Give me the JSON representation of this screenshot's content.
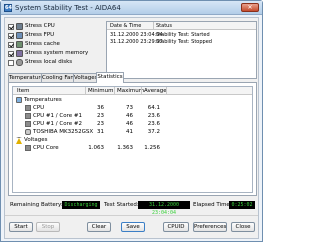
{
  "window": {
    "title": "System Stability Test - AIDA64",
    "icon_glyph": "64"
  },
  "stress_options": [
    {
      "label": "Stress CPU",
      "checked": true,
      "icon": "cpu-icon"
    },
    {
      "label": "Stress FPU",
      "checked": true,
      "icon": "fpu-icon"
    },
    {
      "label": "Stress cache",
      "checked": true,
      "icon": "cache-icon"
    },
    {
      "label": "Stress system memory",
      "checked": true,
      "icon": "memory-icon"
    },
    {
      "label": "Stress local disks",
      "checked": false,
      "icon": "disk-icon"
    }
  ],
  "log": {
    "headers": [
      "Date & Time",
      "Status"
    ],
    "rows": [
      {
        "datetime": "31.12.2000 23:04:04",
        "status": "Stability Test: Started"
      },
      {
        "datetime": "31.12.2000 23:29:07",
        "status": "Stability Test: Stopped"
      }
    ]
  },
  "tabs": [
    "Temperatures",
    "Cooling Fans",
    "Voltages",
    "Statistics"
  ],
  "active_tab": "Statistics",
  "stats": {
    "headers": [
      "Item",
      "Minimum",
      "Maximum",
      "Average"
    ],
    "groups": [
      {
        "label": "Temperatures",
        "rows": [
          {
            "item": "CPU",
            "min": "36",
            "max": "73",
            "avg": "64.1"
          },
          {
            "item": "CPU #1 / Core #1",
            "min": "23",
            "max": "46",
            "avg": "23.6"
          },
          {
            "item": "CPU #1 / Core #2",
            "min": "23",
            "max": "46",
            "avg": "23.6"
          },
          {
            "item": "TOSHIBA MK3252GSX",
            "min": "31",
            "max": "41",
            "avg": "37.2"
          }
        ]
      },
      {
        "label": "Voltages",
        "rows": [
          {
            "item": "CPU Core",
            "min": "1.063",
            "max": "1.363",
            "avg": "1.256"
          }
        ]
      }
    ]
  },
  "status": {
    "battery_label": "Remaining Battery:",
    "battery_value": "Discharging",
    "started_label": "Test Started:",
    "started_value": "31.12.2000 23:04:04",
    "elapsed_label": "Elapsed Time:",
    "elapsed_value": "0:25:02"
  },
  "buttons": {
    "start": "Start",
    "stop": "Stop",
    "clear": "Clear",
    "save": "Save",
    "cpuid": "CPUID",
    "preferences": "Preferences",
    "close": "Close"
  },
  "colors": {
    "status_text": "#39d13a",
    "status_bg": "#000000",
    "titlebar": "#b3cde8"
  }
}
